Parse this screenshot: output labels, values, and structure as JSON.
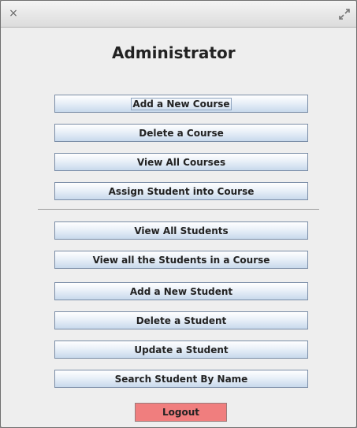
{
  "window": {
    "close_glyph": "×",
    "maximize_icon": "expand-icon"
  },
  "title": "Administrator",
  "course_buttons": [
    "Add a New Course",
    "Delete a Course",
    "View All Courses",
    "Assign Student into Course"
  ],
  "student_buttons": [
    "View All Students",
    "View all the Students in a Course",
    "Add a New Student",
    "Delete a Student",
    "Update a Student",
    "Search Student By Name"
  ],
  "logout": {
    "label": "Logout",
    "color": "#f07e7e"
  }
}
